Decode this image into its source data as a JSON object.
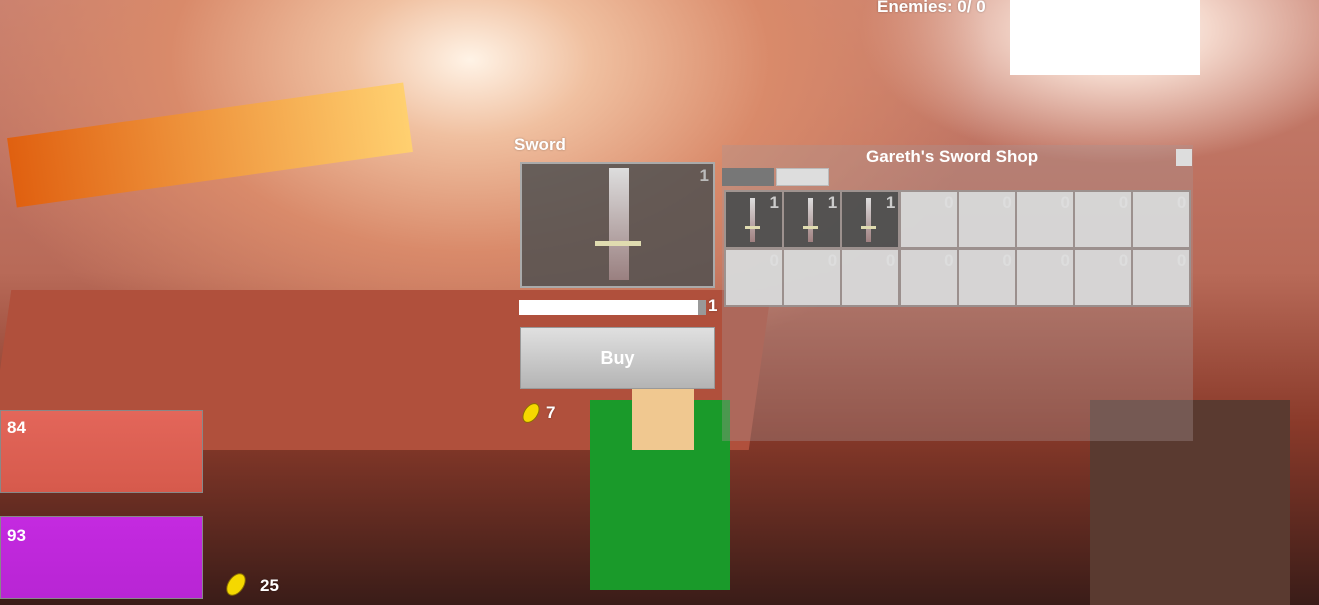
{
  "hud": {
    "enemies": "Enemies: 0/ 0",
    "health": "84",
    "mana": "93",
    "gold": "25",
    "health_color": "#e06055",
    "mana_color": "#c026dd"
  },
  "item_panel": {
    "title": "Sword",
    "preview_count": "1",
    "quantity": "1",
    "quantity_fraction": 1.0,
    "buy_label": "Buy",
    "price": "7"
  },
  "shop": {
    "title": "Gareth's Sword Shop",
    "slots": [
      {
        "item": "sword",
        "count": "1"
      },
      {
        "item": "sword",
        "count": "1"
      },
      {
        "item": "sword",
        "count": "1"
      },
      {
        "item": "",
        "count": "0"
      },
      {
        "item": "",
        "count": "0"
      },
      {
        "item": "",
        "count": "0"
      },
      {
        "item": "",
        "count": "0"
      },
      {
        "item": "",
        "count": "0"
      },
      {
        "item": "",
        "count": "0"
      },
      {
        "item": "",
        "count": "0"
      },
      {
        "item": "",
        "count": "0"
      },
      {
        "item": "",
        "count": "0"
      },
      {
        "item": "",
        "count": "0"
      },
      {
        "item": "",
        "count": "0"
      },
      {
        "item": "",
        "count": "0"
      },
      {
        "item": "",
        "count": "0"
      }
    ]
  }
}
